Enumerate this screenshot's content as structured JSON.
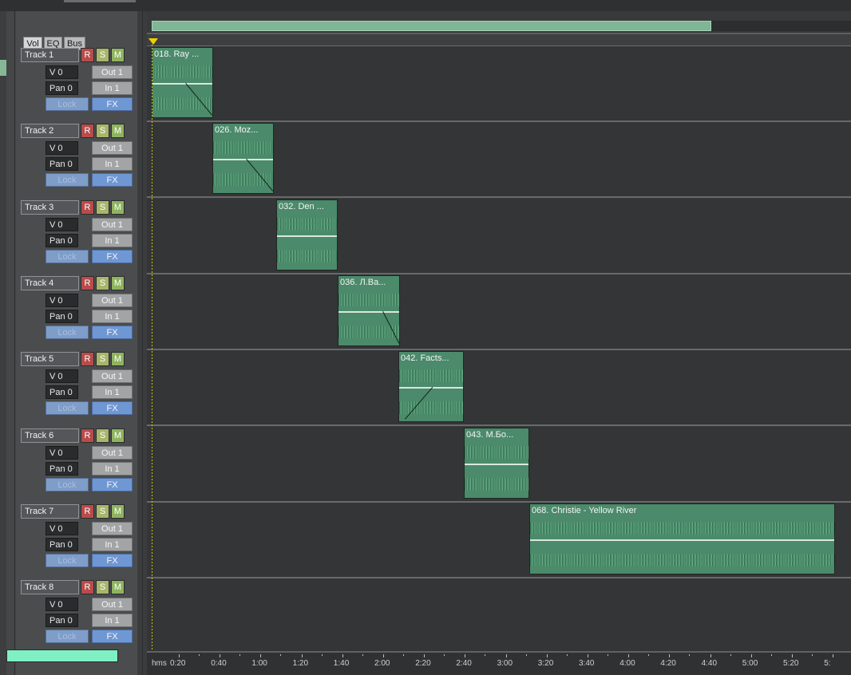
{
  "tabs": [
    "Vol",
    "EQ",
    "Bus"
  ],
  "tracks": [
    {
      "name": "Track 1",
      "r": "R",
      "s": "S",
      "m": "M",
      "vol": "V 0",
      "pan": "Pan 0",
      "out": "Out 1",
      "in": "In 1",
      "lock": "Lock",
      "fx": "FX"
    },
    {
      "name": "Track 2",
      "r": "R",
      "s": "S",
      "m": "M",
      "vol": "V 0",
      "pan": "Pan 0",
      "out": "Out 1",
      "in": "In 1",
      "lock": "Lock",
      "fx": "FX"
    },
    {
      "name": "Track 3",
      "r": "R",
      "s": "S",
      "m": "M",
      "vol": "V 0",
      "pan": "Pan 0",
      "out": "Out 1",
      "in": "In 1",
      "lock": "Lock",
      "fx": "FX"
    },
    {
      "name": "Track 4",
      "r": "R",
      "s": "S",
      "m": "M",
      "vol": "V 0",
      "pan": "Pan 0",
      "out": "Out 1",
      "in": "In 1",
      "lock": "Lock",
      "fx": "FX"
    },
    {
      "name": "Track 5",
      "r": "R",
      "s": "S",
      "m": "M",
      "vol": "V 0",
      "pan": "Pan 0",
      "out": "Out 1",
      "in": "In 1",
      "lock": "Lock",
      "fx": "FX"
    },
    {
      "name": "Track 6",
      "r": "R",
      "s": "S",
      "m": "M",
      "vol": "V 0",
      "pan": "Pan 0",
      "out": "Out 1",
      "in": "In 1",
      "lock": "Lock",
      "fx": "FX"
    },
    {
      "name": "Track 7",
      "r": "R",
      "s": "S",
      "m": "M",
      "vol": "V 0",
      "pan": "Pan 0",
      "out": "Out 1",
      "in": "In 1",
      "lock": "Lock",
      "fx": "FX"
    },
    {
      "name": "Track 8",
      "r": "R",
      "s": "S",
      "m": "M",
      "vol": "V 0",
      "pan": "Pan 0",
      "out": "Out 1",
      "in": "In 1",
      "lock": "Lock",
      "fx": "FX"
    }
  ],
  "clips": [
    {
      "track": 1,
      "title": "018. Ray ..."
    },
    {
      "track": 2,
      "title": "026. Moz..."
    },
    {
      "track": 3,
      "title": "032. Den ..."
    },
    {
      "track": 4,
      "title": "036. Л.Ва..."
    },
    {
      "track": 5,
      "title": "042. Facts..."
    },
    {
      "track": 6,
      "title": "043. М.Бо..."
    },
    {
      "track": 7,
      "title": "068. Christie - Yellow River"
    }
  ],
  "ruler": {
    "unit": "hms",
    "labels": [
      "0:20",
      "0:40",
      "1:00",
      "1:20",
      "1:40",
      "2:00",
      "2:20",
      "2:40",
      "3:00",
      "3:20",
      "3:40",
      "4:00",
      "4:20",
      "4:40",
      "5:00",
      "5:20",
      "5:"
    ]
  },
  "colors": {
    "clip": "#4b8a6a",
    "overview": "#7fb695",
    "rec": "#b84b4b",
    "solo": "#a6b66a",
    "mute": "#8fb45f",
    "fx": "#6f97d4",
    "bottom_indicator": "#7ff0c3"
  }
}
